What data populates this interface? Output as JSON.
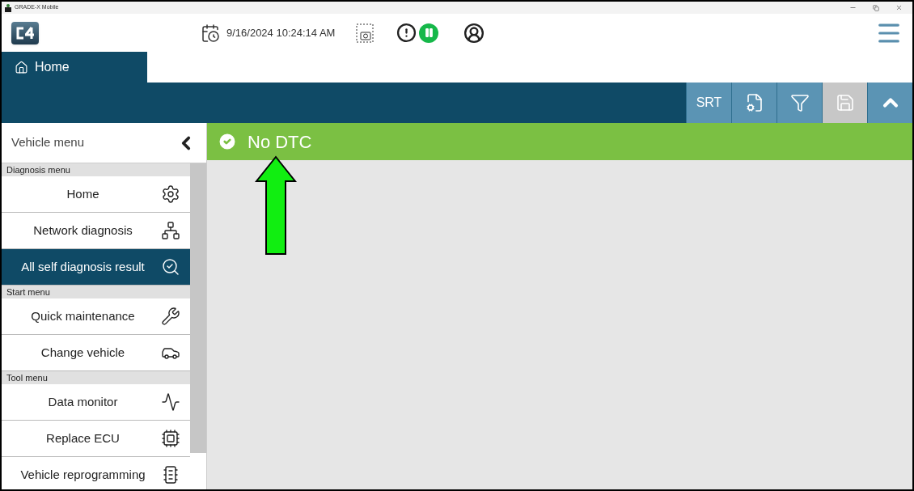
{
  "window": {
    "title": "GRADE-X Mobile"
  },
  "header": {
    "datetime": "9/16/2024 10:24:14 AM",
    "running": true
  },
  "tabs": [
    {
      "label": "Home",
      "selected": true
    }
  ],
  "toolbar": [
    {
      "kind": "text",
      "label": "SRT",
      "disabled": false
    },
    {
      "kind": "icon",
      "disabled": false
    },
    {
      "kind": "icon",
      "disabled": false
    },
    {
      "kind": "icon",
      "disabled": true
    },
    {
      "kind": "icon",
      "disabled": false
    }
  ],
  "sidebar": {
    "title": "Vehicle menu",
    "sections": [
      {
        "title": "Diagnosis menu",
        "items": [
          {
            "label": "Home",
            "selected": false
          },
          {
            "label": "Network diagnosis",
            "selected": false
          },
          {
            "label": "All self diagnosis result",
            "selected": true
          }
        ]
      },
      {
        "title": "Start menu",
        "items": [
          {
            "label": "Quick maintenance",
            "selected": false
          },
          {
            "label": "Change vehicle",
            "selected": false
          }
        ]
      },
      {
        "title": "Tool menu",
        "items": [
          {
            "label": "Data monitor",
            "selected": false
          },
          {
            "label": "Replace ECU",
            "selected": false
          },
          {
            "label": "Vehicle reprogramming",
            "selected": false
          }
        ]
      }
    ]
  },
  "result": {
    "passed": true,
    "message": "No DTC"
  }
}
